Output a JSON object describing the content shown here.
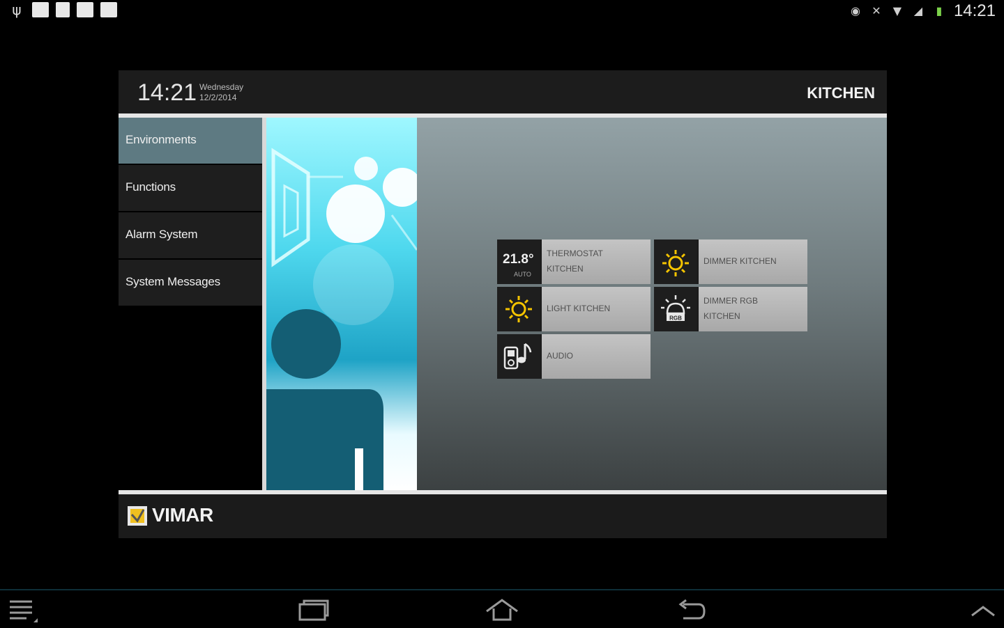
{
  "status_bar": {
    "left_icons": [
      "usb-icon",
      "image-icon",
      "document-icon",
      "checkbox-icon",
      "play-store-icon"
    ],
    "right_icons": [
      "eye-icon",
      "mute-icon",
      "wifi-icon",
      "signal-icon",
      "battery-icon"
    ],
    "clock": "14:21"
  },
  "header": {
    "time": "14:21",
    "day": "Wednesday",
    "date": "12/2/2014",
    "room": "KITCHEN"
  },
  "sidebar": {
    "items": [
      {
        "label": "Environments",
        "active": true
      },
      {
        "label": "Functions",
        "active": false
      },
      {
        "label": "Alarm System",
        "active": false
      },
      {
        "label": "System Messages",
        "active": false
      }
    ]
  },
  "tiles": [
    {
      "label_line1": "THERMOSTAT",
      "label_line2": "KITCHEN",
      "icon": "thermostat-icon",
      "temp": "21.8°",
      "mode": "AUTO"
    },
    {
      "label_line1": "DIMMER KITCHEN",
      "label_line2": "",
      "icon": "sun-icon"
    },
    {
      "label_line1": "LIGHT KITCHEN",
      "label_line2": "",
      "icon": "sun-icon"
    },
    {
      "label_line1": "DIMMER RGB",
      "label_line2": "KITCHEN",
      "icon": "rgb-lamp-icon",
      "badge": "RGB"
    },
    {
      "label_line1": "AUDIO",
      "label_line2": "",
      "icon": "audio-icon"
    }
  ],
  "footer": {
    "brand": "VIMAR"
  },
  "nav_bar": {
    "buttons": [
      "menu-icon",
      "recent-apps-icon",
      "home-icon",
      "back-icon",
      "chevron-up-icon"
    ]
  },
  "colors": {
    "active_nav": "#5e7a82",
    "icon_yellow": "#f5c400",
    "content_top": "#93a2a6",
    "content_bottom": "#3c4142"
  }
}
